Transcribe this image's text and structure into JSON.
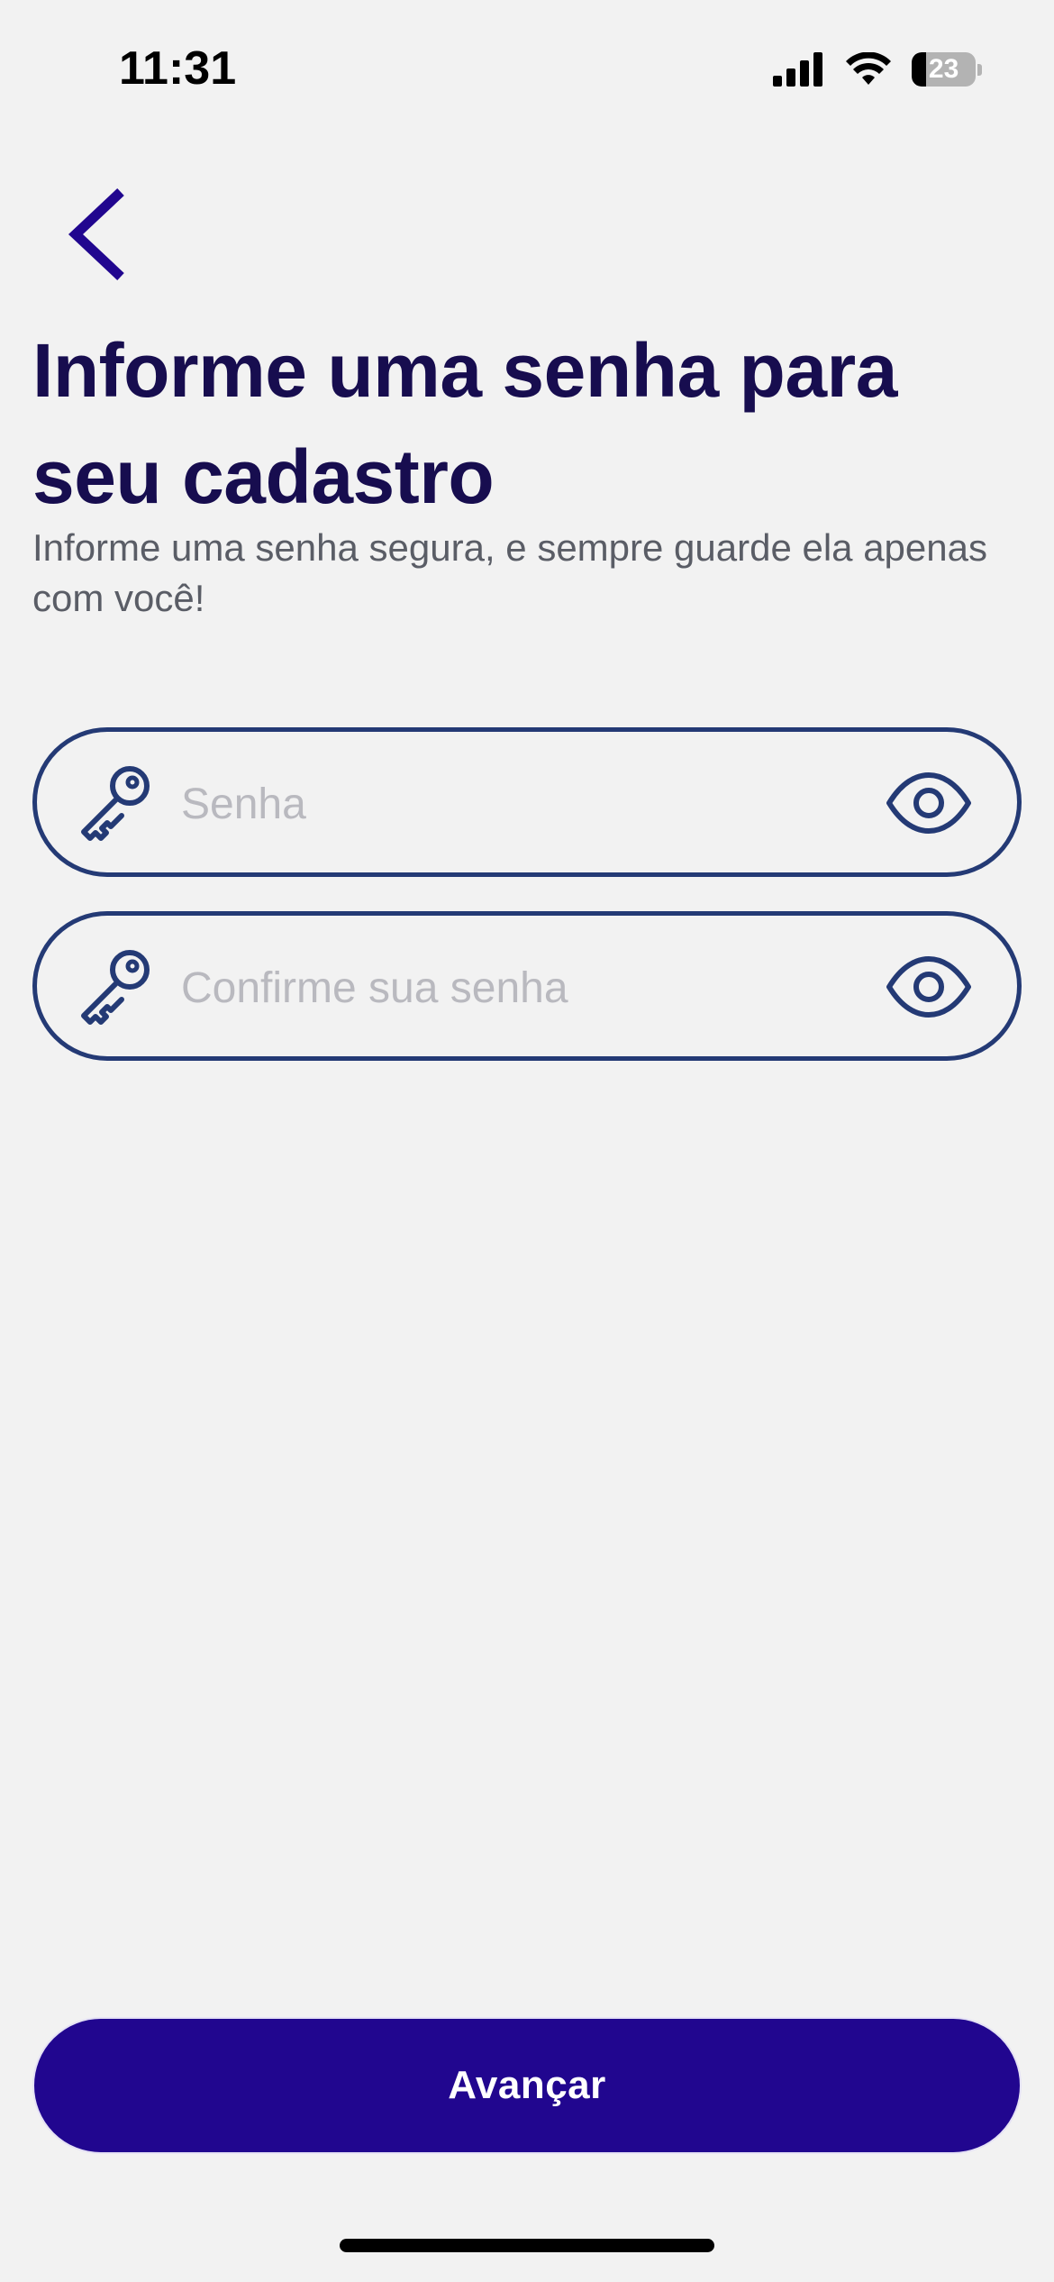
{
  "status_bar": {
    "time": "11:31",
    "battery_level": "23",
    "battery_fraction": 0.23,
    "signal_icon": "cellular-signal-icon",
    "wifi_icon": "wifi-icon"
  },
  "navigation": {
    "back_icon": "chevron-left-icon"
  },
  "header": {
    "title": "Informe uma senha para seu cadastro",
    "subtitle": "Informe uma senha segura, e sempre guarde ela apenas com você!"
  },
  "form": {
    "password": {
      "placeholder": "Senha",
      "value": "",
      "leading_icon": "key-icon",
      "trailing_icon": "eye-icon"
    },
    "confirm_password": {
      "placeholder": "Confirme sua senha",
      "value": "",
      "leading_icon": "key-icon",
      "trailing_icon": "eye-icon"
    }
  },
  "actions": {
    "next_label": "Avançar"
  },
  "colors": {
    "background": "#f2f2f2",
    "title": "#170d4f",
    "subtitle": "#5a5d66",
    "field_border": "#243a75",
    "primary_button": "#21068f",
    "primary_button_text": "#ffffff",
    "back_chevron": "#21068f"
  }
}
